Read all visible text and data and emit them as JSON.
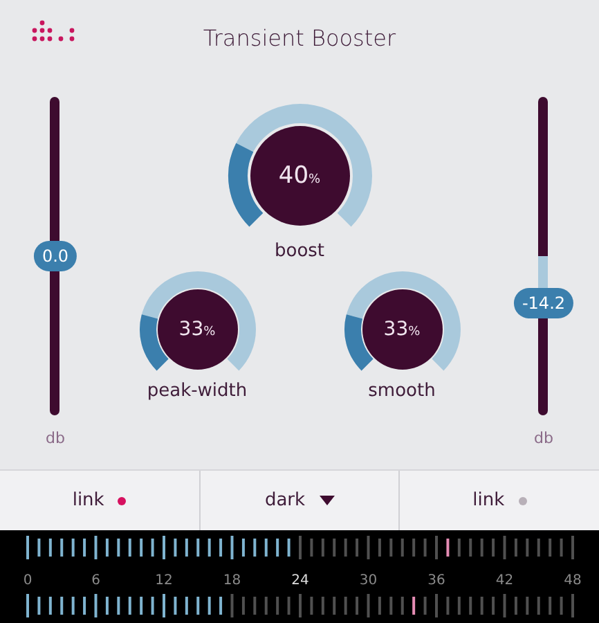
{
  "header": {
    "title": "Transient Booster"
  },
  "sliders": [
    {
      "reading": "0.0",
      "unit": "db",
      "level": 0.5
    },
    {
      "reading": "-14.2",
      "unit": "db",
      "level": 0.35
    }
  ],
  "knobs": [
    {
      "label": "boost",
      "value": "40",
      "unit": "%"
    },
    {
      "label": "peak-width",
      "value": "33",
      "unit": "%"
    },
    {
      "label": "smooth",
      "value": "33",
      "unit": "%"
    }
  ],
  "footer": [
    {
      "kind": "toggle",
      "label": "link",
      "on": true
    },
    {
      "kind": "dropdown",
      "label": "dark"
    },
    {
      "kind": "toggle",
      "label": "link",
      "on": false
    }
  ],
  "scale": [
    "0",
    "6",
    "12",
    "18",
    "24",
    "30",
    "36",
    "42",
    "48"
  ]
}
